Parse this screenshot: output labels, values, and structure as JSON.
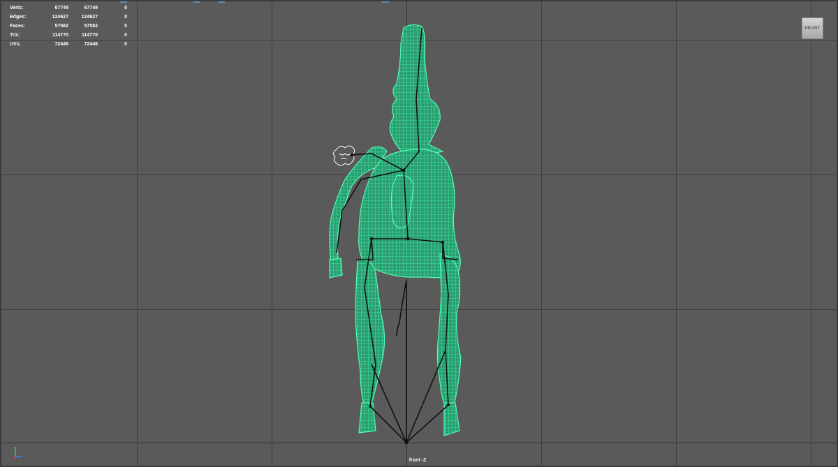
{
  "stats": [
    {
      "label": "Verts:",
      "v1": "67749",
      "v2": "67749",
      "v3": "0"
    },
    {
      "label": "Edges:",
      "v1": "124627",
      "v2": "124627",
      "v3": "0"
    },
    {
      "label": "Faces:",
      "v1": "57582",
      "v2": "57582",
      "v3": "0"
    },
    {
      "label": "Tris:",
      "v1": "114770",
      "v2": "114770",
      "v3": "0"
    },
    {
      "label": "UVs:",
      "v1": "72446",
      "v2": "72446",
      "v3": "0"
    }
  ],
  "view_cube": {
    "label": "FRONT"
  },
  "camera": {
    "label": "front -Z"
  },
  "axis": {
    "y_color": "#3fd23f",
    "z_color": "#3f7fff",
    "x_color": "#e04040"
  },
  "colors": {
    "viewport_bg": "#5a5a5a",
    "grid": "#3f3f3f",
    "wireframe": "#33f3a0",
    "mesh_fill": "#2e9c73",
    "joints": "#111111"
  }
}
